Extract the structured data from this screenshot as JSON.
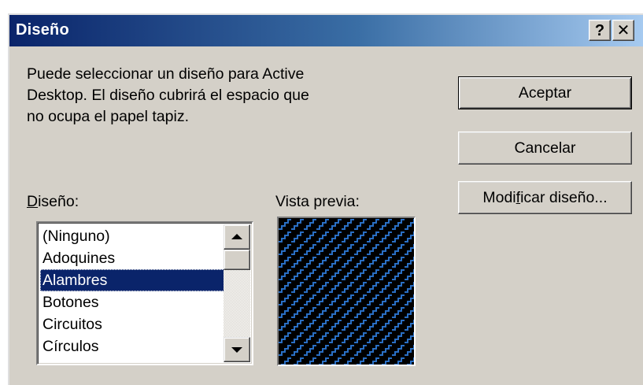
{
  "window": {
    "title": "Diseño",
    "help_glyph": "?",
    "close_glyph": "✕"
  },
  "description": "Puede seleccionar un diseño para Active\nDesktop. El diseño cubrirá el espacio que\nno ocupa el papel tapiz.",
  "buttons": {
    "accept": "Aceptar",
    "cancel": "Cancelar",
    "modify_pre": "Modi",
    "modify_mnemonic": "f",
    "modify_post": "icar diseño..."
  },
  "design_label": {
    "mnemonic": "D",
    "rest": "iseño:"
  },
  "preview_label": "Vista previa:",
  "design_list": {
    "items": [
      "(Ninguno)",
      "Adoquines",
      "Alambres",
      "Botones",
      "Circuitos",
      "Círculos"
    ],
    "selected": "Alambres"
  },
  "icons": {
    "help": "help-icon",
    "close": "close-icon",
    "scroll_up": "arrow-up-icon",
    "scroll_down": "arrow-down-icon"
  },
  "colors": {
    "title_bar": "#0a246a",
    "selection": "#0a246a",
    "dialog_face": "#d4d0c8",
    "pattern_foreground": "#2a6fc4",
    "pattern_background": "#000000"
  }
}
